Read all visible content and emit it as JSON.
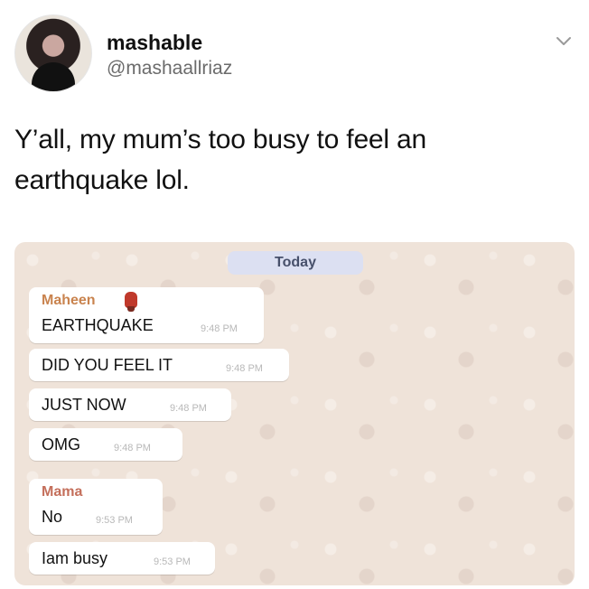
{
  "tweet": {
    "display_name": "mashable",
    "handle": "@mashaallriaz",
    "text": "Y’all, my mum’s too busy to feel an earthquake lol.",
    "menu_icon": "chevron-down-icon"
  },
  "chat": {
    "date_label": "Today",
    "messages": [
      {
        "sender": "Maheen",
        "sender_icon": "phone-emoji-icon",
        "text": "EARTHQUAKE",
        "time": "9:48 PM"
      },
      {
        "text": "DID YOU FEEL IT",
        "time": "9:48 PM"
      },
      {
        "text": "JUST NOW",
        "time": "9:48 PM"
      },
      {
        "text": "OMG",
        "time": "9:48 PM"
      },
      {
        "sender": "Mama",
        "text": "No",
        "time": "9:53 PM"
      },
      {
        "text": "Iam busy",
        "time": "9:53 PM"
      }
    ]
  }
}
